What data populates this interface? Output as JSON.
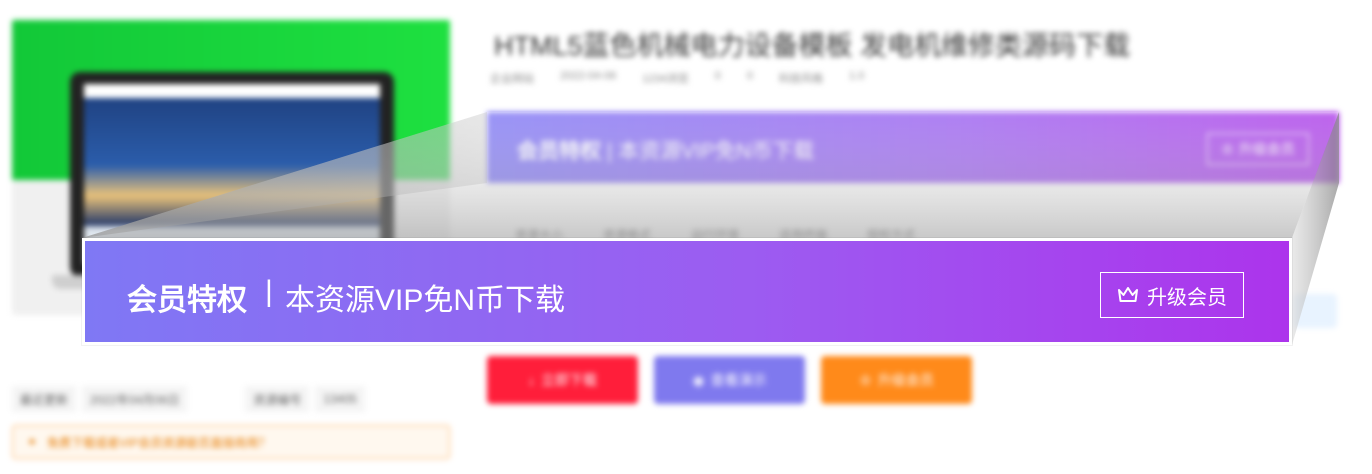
{
  "page": {
    "title": "HTML5蓝色机械电力设备模板 发电机维修类源码下载",
    "meta": [
      "企业网站",
      "2022-04-06",
      "1234浏览",
      "0",
      "0",
      "科技风格",
      "1.0"
    ],
    "info": [
      "资源大小",
      "资源格式",
      "运行环境",
      "适用终端",
      "授权方式"
    ],
    "buttons": {
      "download": "立即下载",
      "demo": "查看演示",
      "upgrade": "升级会员"
    },
    "update": {
      "label": "最近更新",
      "date": "2022年04月06日",
      "downloads_label": "资源编号",
      "downloads_value": "13405"
    },
    "notice": "免费下载或者VIP会员资源能否直接商用？"
  },
  "vip_banner": {
    "strong": "会员特权",
    "separator": "|",
    "desc": "本资源VIP免N币下载",
    "button_label": "升级会员",
    "button_icon": "crown-icon"
  },
  "colors": {
    "vip_gradient_start": "#7f78f4",
    "vip_gradient_end": "#ac34ec",
    "download_red": "#ff1e3a",
    "demo_purple": "#7f79ee",
    "upgrade_orange": "#ff8a1a",
    "thumb_green": "#12c838"
  }
}
